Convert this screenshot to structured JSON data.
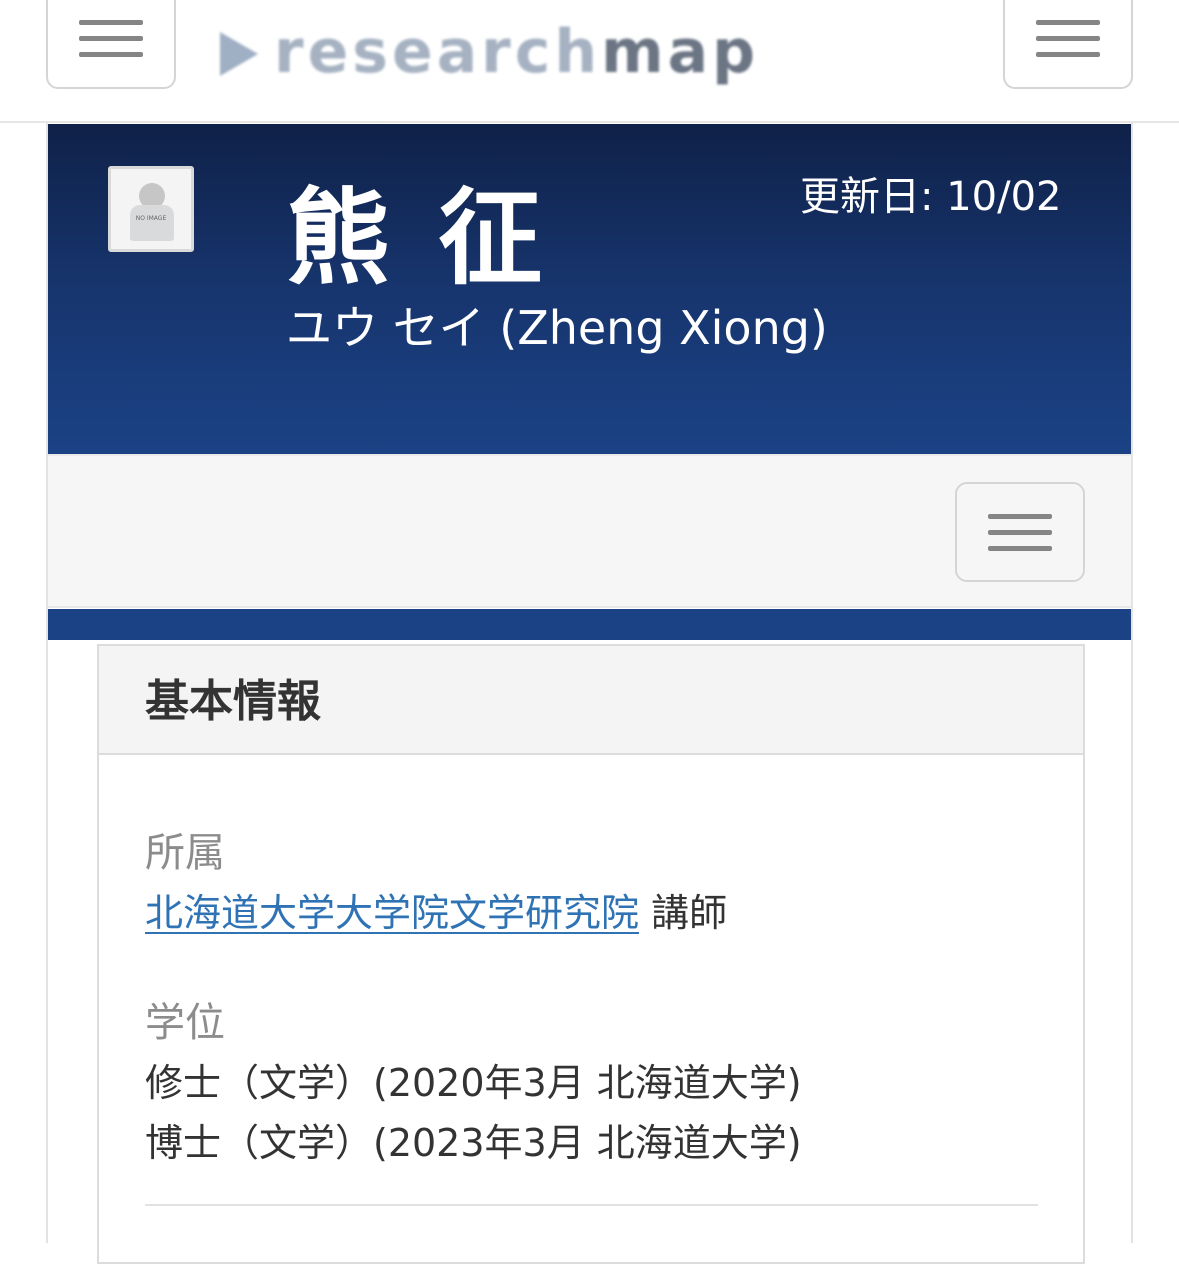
{
  "header": {
    "logo_text_light": "research",
    "logo_text_dark": "map",
    "left_menu_icon": "hamburger-icon",
    "right_menu_icon": "hamburger-icon"
  },
  "profile": {
    "name": "熊 征",
    "reading": "ユウ セイ  (Zheng Xiong)",
    "updated": "更新日: 10/02",
    "avatar_placeholder": "NO IMAGE"
  },
  "nav": {
    "menu_icon": "hamburger-icon"
  },
  "basic_info": {
    "title": "基本情報",
    "affiliation_label": "所属",
    "affiliation_link": "北海道大学大学院文学研究院",
    "affiliation_position": " 講師",
    "degree_label": "学位",
    "degrees": [
      "修士（文学）(2020年3月 北海道大学)",
      "博士（文学）(2023年3月 北海道大学)"
    ]
  },
  "colors": {
    "banner_top": "#0f2148",
    "banner_bottom": "#1b4285",
    "link": "#2f73b5",
    "label": "#8c8c8c"
  }
}
